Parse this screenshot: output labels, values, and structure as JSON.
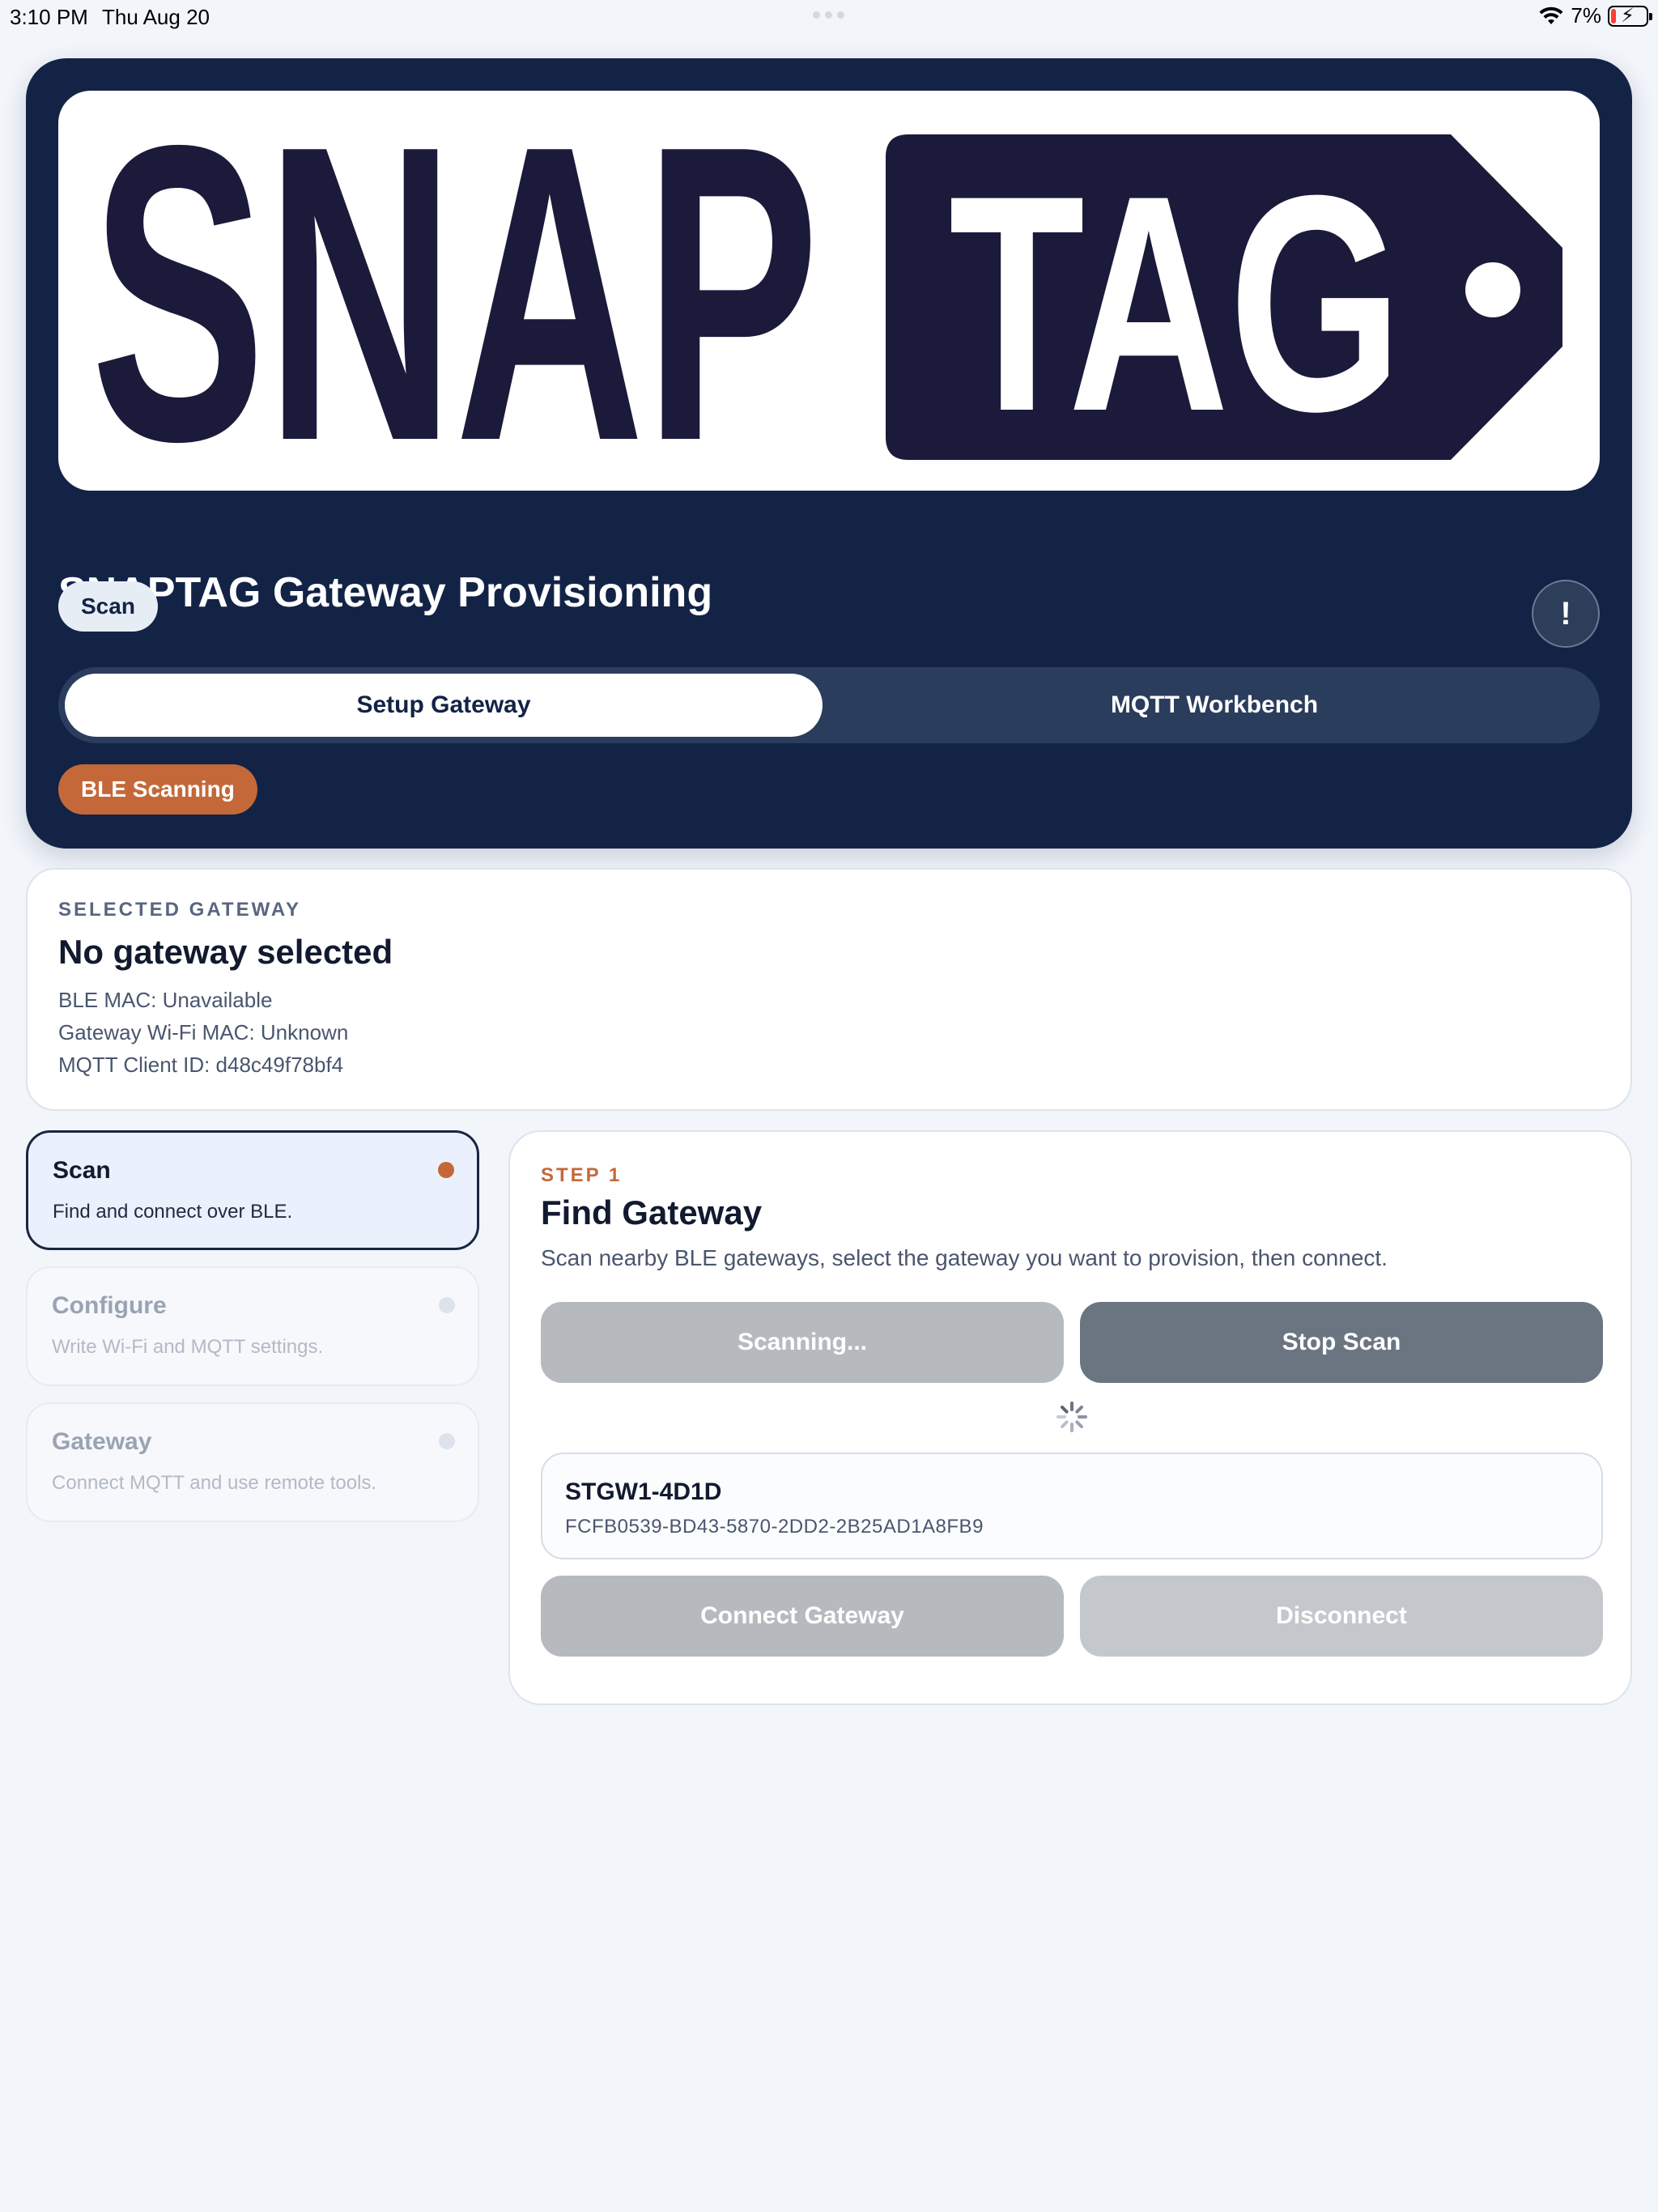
{
  "status_bar": {
    "time": "3:10 PM",
    "date": "Thu Aug 20",
    "battery_percent": "7%",
    "icons": [
      "wifi-icon",
      "battery-charging-icon"
    ]
  },
  "header": {
    "logo_text": "SNAP TAG",
    "logo_words": [
      "SNAP",
      "TAG"
    ],
    "title": "SNAPTAG Gateway Provisioning",
    "step_pill": "Scan",
    "info_button": "!",
    "tabs": [
      {
        "label": "Setup Gateway",
        "active": true
      },
      {
        "label": "MQTT Workbench",
        "active": false
      }
    ],
    "status_pill": "BLE Scanning"
  },
  "selected_gateway": {
    "eyebrow": "SELECTED GATEWAY",
    "title": "No gateway selected",
    "ble_mac": "BLE MAC: Unavailable",
    "wifi_mac": "Gateway Wi-Fi MAC: Unknown",
    "mqtt_client_id": "MQTT Client ID: d48c49f78bf4"
  },
  "steps": [
    {
      "title": "Scan",
      "desc": "Find and connect over BLE.",
      "active": true
    },
    {
      "title": "Configure",
      "desc": "Write Wi-Fi and MQTT settings.",
      "active": false
    },
    {
      "title": "Gateway",
      "desc": "Connect MQTT and use remote tools.",
      "active": false
    }
  ],
  "main": {
    "step_label": "STEP 1",
    "title": "Find Gateway",
    "description": "Scan nearby BLE gateways, select the gateway you want to provision, then connect.",
    "scanning_button": "Scanning...",
    "stop_button": "Stop Scan",
    "devices": [
      {
        "name": "STGW1-4D1D",
        "id": "FCFB0539-BD43-5870-2DD2-2B25AD1A8FB9"
      }
    ],
    "connect_button": "Connect Gateway",
    "disconnect_button": "Disconnect"
  },
  "colors": {
    "navy": "#122346",
    "logo_navy": "#1c1a3a",
    "accent_orange": "#c4683a",
    "background": "#f2f5fa"
  }
}
